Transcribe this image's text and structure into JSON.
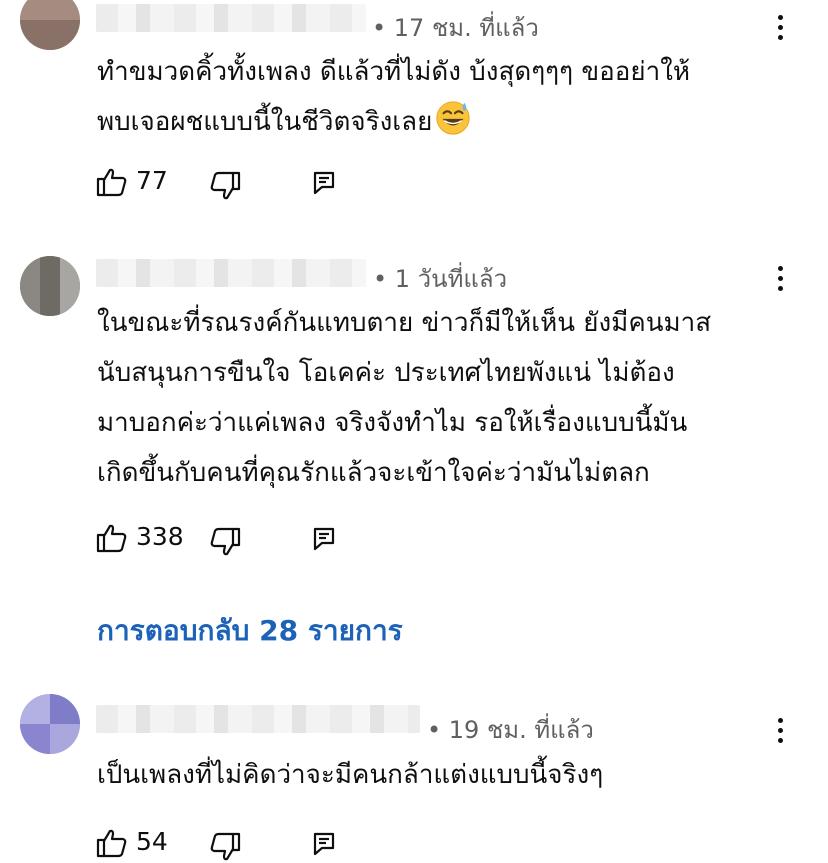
{
  "comments": [
    {
      "time": "• 17 ชม. ที่แล้ว",
      "lines": [
        "ทำขมวดคิ้วทั้งเพลง ดีแล้วที่ไม่ดัง บ้งสุดๆๆๆ ขออย่าให้",
        "พบเจอผชแบบนี้ในชีวิตจริงเลย"
      ],
      "emoji": "sweat-smile-emoji",
      "likes": "77"
    },
    {
      "time": "• 1 วันที่แล้ว",
      "lines": [
        "ในขณะที่รณรงค์กันแทบตาย ข่าวก็มีให้เห็น ยังมีคนมาส",
        "นับสนุนการขืนใจ โอเคค่ะ ประเทศไทยพังแน่ ไม่ต้อง",
        "มาบอกค่ะว่าแค่เพลง จริงจังทำไม รอให้เรื่องแบบนี้มัน",
        "เกิดขึ้นกับคนที่คุณรักแล้วจะเข้าใจค่ะว่ามันไม่ตลก"
      ],
      "likes": "338",
      "replies": "การตอบกลับ 28 รายการ"
    },
    {
      "time": "• 19 ชม. ที่แล้ว",
      "lines": [
        "เป็นเพลงที่ไม่คิดว่าจะมีคนกล้าแต่งแบบนี้จริงๆ"
      ],
      "likes": "54"
    }
  ],
  "icons": {
    "like": "thumb-up-icon",
    "dislike": "thumb-down-icon",
    "reply": "reply-icon",
    "more": "more-vert-icon"
  },
  "colors": {
    "link": "#1c62b9",
    "meta": "#606060",
    "text": "#0f0f0f"
  }
}
